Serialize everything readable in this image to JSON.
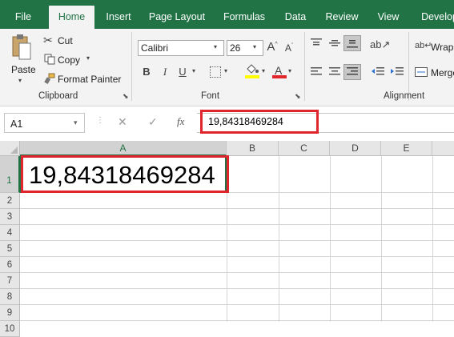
{
  "tabs": [
    "File",
    "Home",
    "Insert",
    "Page Layout",
    "Formulas",
    "Data",
    "Review",
    "View",
    "Develop"
  ],
  "clipboard": {
    "paste": "Paste",
    "cut": "Cut",
    "copy": "Copy",
    "format_painter": "Format Painter",
    "group": "Clipboard"
  },
  "font": {
    "name": "Calibri",
    "size": "26",
    "bold": "B",
    "italic": "I",
    "underline": "U",
    "grow": "A",
    "shrink": "A",
    "font_color_letter": "A",
    "group": "Font"
  },
  "alignment": {
    "wrap": "Wrap",
    "merge": "Merge",
    "group": "Alignment"
  },
  "formula_bar": {
    "name_box": "A1",
    "fx": "fx",
    "content": "19,84318469284"
  },
  "columns": [
    "A",
    "B",
    "C",
    "D",
    "E"
  ],
  "rows": [
    "1",
    "2",
    "3",
    "4",
    "5",
    "6",
    "7",
    "8",
    "9",
    "10"
  ],
  "cells": {
    "A1": "19,84318469284"
  },
  "colors": {
    "excel_green": "#217346",
    "highlight_red": "#e0252d",
    "font_color_bar": "#e0252d",
    "fill_color_bar": "#ffff00"
  }
}
